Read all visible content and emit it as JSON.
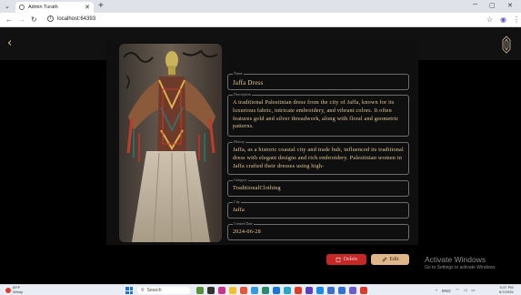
{
  "browser": {
    "tab_title": "Admin Turath",
    "url": "localhost:64393",
    "new_tab": "+",
    "close": "✕",
    "minimize": "─",
    "maximize": "▢",
    "close_window": "✕"
  },
  "app": {
    "back_symbol": "‹",
    "page_title": "Jaffa Dress"
  },
  "fields": {
    "name": {
      "label": "Name",
      "value": "Jaffa Dress"
    },
    "description": {
      "label": "Description",
      "value": "A traditional Palestinian dress from the city of Jaffa, known for its luxurious fabric, intricate embroidery, and vibrant colors. It often features gold and silver threadwork, along with floral and geometric patterns."
    },
    "history": {
      "label": "History",
      "value": "Jaffa, as a historic coastal city and trade hub, influenced its traditional dress with elegant designs and rich embroidery. Palestinian women in Jaffa crafted their dresses using high-"
    },
    "category": {
      "label": "Category",
      "value": "TraditionalClothing"
    },
    "city": {
      "label": "City",
      "value": "Jaffa"
    },
    "created_date": {
      "label": "Created Date",
      "value": "2024-06-28"
    }
  },
  "actions": {
    "delete_label": "Delete",
    "edit_label": "Edit"
  },
  "watermark": {
    "title": "Activate Windows",
    "subtitle": "Go to Settings to activate Windows."
  },
  "taskbar": {
    "weather_label": "69°F",
    "weather_sub": "Windy",
    "search_placeholder": "Search",
    "tray_lang": "ENG",
    "time": "5:37 PM",
    "date": "6/7/2025"
  },
  "colors": {
    "accent_gold": "#e6c99a",
    "delete_red": "#c62828",
    "edit_tan": "#e0b58a"
  }
}
